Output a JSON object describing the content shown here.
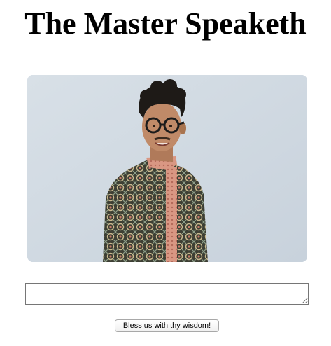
{
  "page": {
    "title": "The Master Speaketh"
  },
  "portrait": {
    "subject": "smiling man with curly dark hair and round glasses wearing a patterned shirt",
    "background_color": "#d5dde4"
  },
  "form": {
    "input_value": "",
    "button_label": "Bless us with thy wisdom!"
  }
}
